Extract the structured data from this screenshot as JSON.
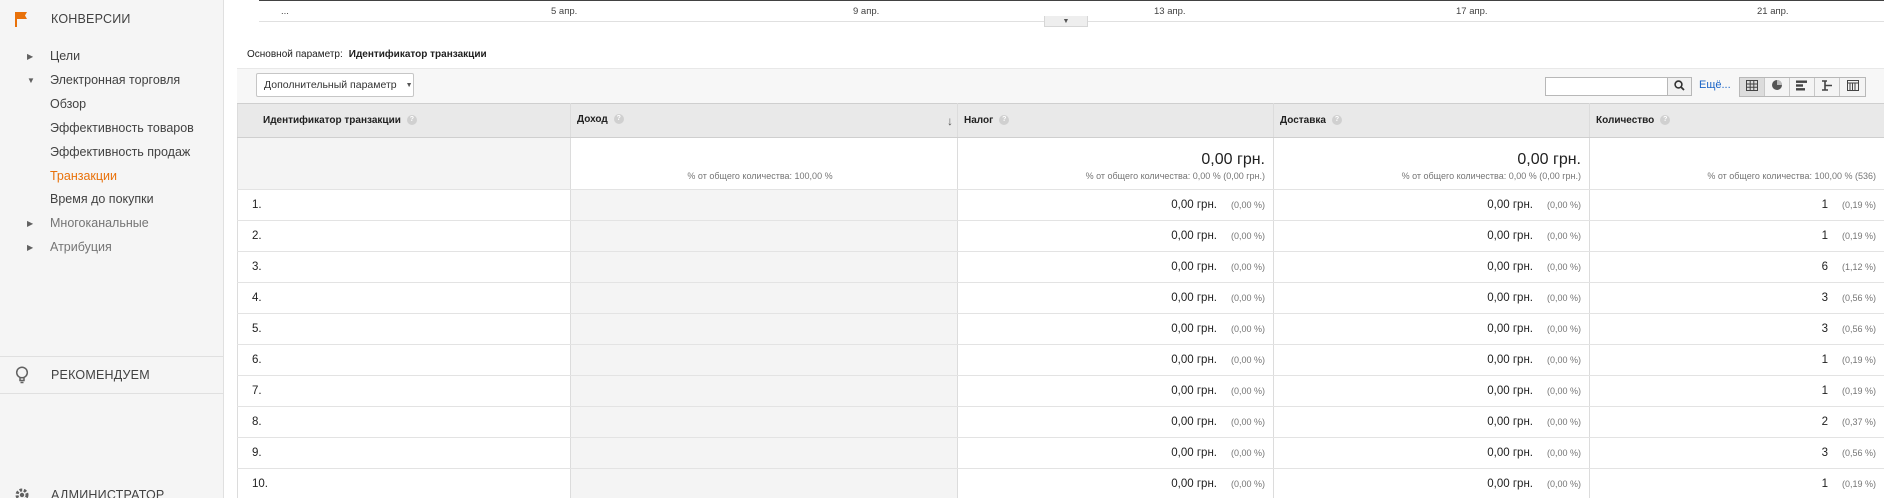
{
  "sidebar": {
    "conversions_title": "КОНВЕРСИИ",
    "items": [
      {
        "label": "Цели"
      },
      {
        "label": "Электронная торговля"
      },
      {
        "label": "Обзор"
      },
      {
        "label": "Эффективность товаров"
      },
      {
        "label": "Эффективность продаж"
      },
      {
        "label": "Транзакции"
      },
      {
        "label": "Время до покупки"
      },
      {
        "label": "Многоканальные"
      },
      {
        "label": "Атрибуция"
      }
    ],
    "recommend_title": "РЕКОМЕНДУЕМ",
    "admin_title": "АДМИНИСТРАТОР",
    "accent_color": "#e8710a"
  },
  "timeline": {
    "labels": [
      "...",
      "5 апр.",
      "9 апр.",
      "13 апр.",
      "17 апр.",
      "21 апр."
    ]
  },
  "primary_dimension": {
    "label": "Основной параметр:",
    "value": "Идентификатор транзакции"
  },
  "toolbar": {
    "secondary_dimension_label": "Дополнительный параметр",
    "search_value": "",
    "more_label": "Ещё..."
  },
  "table": {
    "headers": [
      "Идентификатор транзакции",
      "Доход",
      "Налог",
      "Доставка",
      "Количество"
    ],
    "totals": {
      "revenue_pct": "% от общего количества: 100,00 %",
      "tax_value": "0,00 грн.",
      "tax_pct": "% от общего количества: 0,00 % (0,00 грн.)",
      "shipping_value": "0,00 грн.",
      "shipping_pct": "% от общего количества: 0,00 % (0,00 грн.)",
      "quantity_pct": "% от общего количества: 100,00 % (536)"
    },
    "rows": [
      {
        "n": "1.",
        "tax": "0,00 грн.",
        "tax_pct": "(0,00 %)",
        "ship": "0,00 грн.",
        "ship_pct": "(0,00 %)",
        "qty": "1",
        "qty_pct": "(0,19 %)"
      },
      {
        "n": "2.",
        "tax": "0,00 грн.",
        "tax_pct": "(0,00 %)",
        "ship": "0,00 грн.",
        "ship_pct": "(0,00 %)",
        "qty": "1",
        "qty_pct": "(0,19 %)"
      },
      {
        "n": "3.",
        "tax": "0,00 грн.",
        "tax_pct": "(0,00 %)",
        "ship": "0,00 грн.",
        "ship_pct": "(0,00 %)",
        "qty": "6",
        "qty_pct": "(1,12 %)"
      },
      {
        "n": "4.",
        "tax": "0,00 грн.",
        "tax_pct": "(0,00 %)",
        "ship": "0,00 грн.",
        "ship_pct": "(0,00 %)",
        "qty": "3",
        "qty_pct": "(0,56 %)"
      },
      {
        "n": "5.",
        "tax": "0,00 грн.",
        "tax_pct": "(0,00 %)",
        "ship": "0,00 грн.",
        "ship_pct": "(0,00 %)",
        "qty": "3",
        "qty_pct": "(0,56 %)"
      },
      {
        "n": "6.",
        "tax": "0,00 грн.",
        "tax_pct": "(0,00 %)",
        "ship": "0,00 грн.",
        "ship_pct": "(0,00 %)",
        "qty": "1",
        "qty_pct": "(0,19 %)"
      },
      {
        "n": "7.",
        "tax": "0,00 грн.",
        "tax_pct": "(0,00 %)",
        "ship": "0,00 грн.",
        "ship_pct": "(0,00 %)",
        "qty": "1",
        "qty_pct": "(0,19 %)"
      },
      {
        "n": "8.",
        "tax": "0,00 грн.",
        "tax_pct": "(0,00 %)",
        "ship": "0,00 грн.",
        "ship_pct": "(0,00 %)",
        "qty": "2",
        "qty_pct": "(0,37 %)"
      },
      {
        "n": "9.",
        "tax": "0,00 грн.",
        "tax_pct": "(0,00 %)",
        "ship": "0,00 грн.",
        "ship_pct": "(0,00 %)",
        "qty": "3",
        "qty_pct": "(0,56 %)"
      },
      {
        "n": "10.",
        "tax": "0,00 грн.",
        "tax_pct": "(0,00 %)",
        "ship": "0,00 грн.",
        "ship_pct": "(0,00 %)",
        "qty": "1",
        "qty_pct": "(0,19 %)"
      }
    ]
  }
}
